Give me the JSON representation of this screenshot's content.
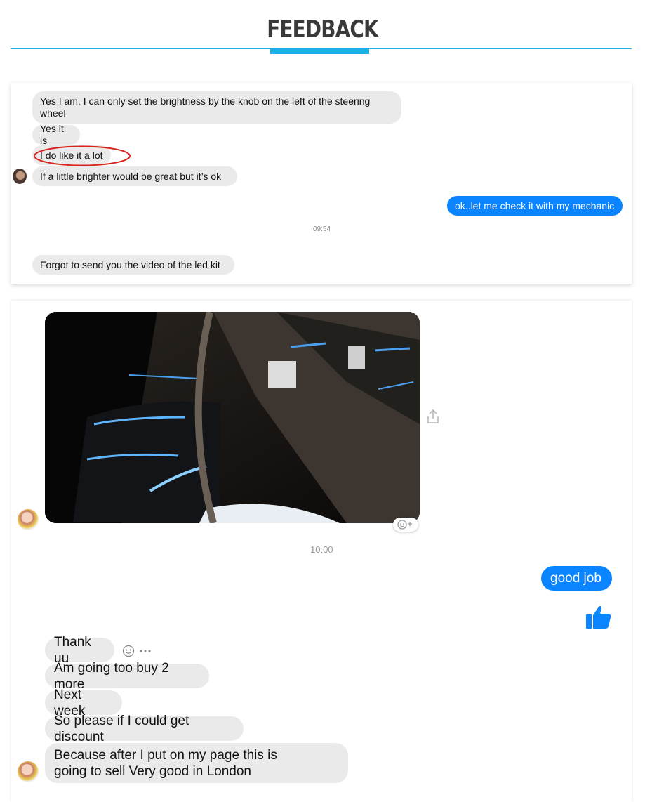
{
  "header": {
    "title": "FEEDBACK"
  },
  "chat1": {
    "messages": [
      "Yes I am. I can only set the brightness by the knob on the left of the steering wheel",
      "Yes it is",
      "I do like it a lot",
      "If a little brighter would be great but it’s ok"
    ],
    "outgoing": "ok..let me check it with my mechanic",
    "timestamp": "09:54",
    "last_message": "Forgot to send you the video of the led kit"
  },
  "chat2": {
    "timestamp": "10:00",
    "outgoing": "good job",
    "messages": [
      "Thank uu",
      "Am going too buy 2 more",
      "Next week",
      "So please if I could get discount",
      "Because after I put on my page this is going to sell Very good in London"
    ],
    "icons": {
      "share": "share-icon",
      "react": "emoji-react-icon",
      "like": "thumbs-up-icon",
      "more": "more-icon"
    },
    "accent": "#0b84ff"
  },
  "colors": {
    "brand": "#1bb0e8",
    "bubble_in": "#eaeaea",
    "bubble_out": "#0b84ff"
  }
}
